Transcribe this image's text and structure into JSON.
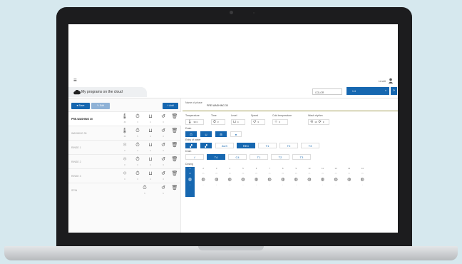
{
  "app": {
    "menu_icon": "menu-icon",
    "user_name": "Lenzitt",
    "cloud_title": "My programs on the cloud",
    "search_text": "COLOR",
    "select_value": "1 4",
    "select_clear": "×",
    "select_go": "»"
  },
  "toolbar": {
    "save_label": "Save",
    "edit_label": "Edit",
    "add_label": "Add"
  },
  "columns": [
    "temperature-icon",
    "time-icon",
    "level-icon",
    "speed-icon",
    "delete-icon"
  ],
  "programs": [
    {
      "name": "PRE-WASHING 30",
      "values": [
        "30",
        "3",
        "4",
        "3"
      ]
    },
    {
      "name": "WASHING 30",
      "values": [
        "30",
        "5",
        "4",
        "3"
      ]
    },
    {
      "name": "RINSE 1",
      "values": [
        "0",
        "3",
        "4",
        "3"
      ]
    },
    {
      "name": "RINSE 2",
      "values": [
        "0",
        "3",
        "4",
        "3"
      ]
    },
    {
      "name": "RINSE 3",
      "values": [
        "0",
        "3",
        "4",
        "3"
      ]
    },
    {
      "name": "SPIN",
      "values": [
        "",
        "5",
        "",
        "5"
      ]
    }
  ],
  "detail": {
    "name_label": "Name of phase",
    "name_value": "PRE-WASHING 30",
    "params": {
      "temperature": {
        "label": "Temperature",
        "value": "30 C"
      },
      "time": {
        "label": "Time",
        "value": "3"
      },
      "level": {
        "label": "Level",
        "value": "4"
      },
      "speed": {
        "label": "Speed",
        "value": "3"
      },
      "cold_temp": {
        "label": "Cold temperature",
        "value": "0"
      },
      "wash_rhythm": {
        "label": "Wash rhythm",
        "value1": "10",
        "value2": "3"
      }
    },
    "drain_section": "Drain",
    "entry_section": "Entry of water",
    "drain2_section": "Drain",
    "dosing_section": "Dosing",
    "entry_tiles": [
      "",
      "",
      "AUX",
      "REC",
      "T1",
      "T2",
      "T3"
    ],
    "drain_tiles": [
      "",
      "T4",
      "C4",
      "T1",
      "T2",
      "T3"
    ],
    "dosing": [
      {
        "n": "1"
      },
      {
        "n": "2"
      },
      {
        "n": "3"
      },
      {
        "n": "4"
      },
      {
        "n": "5"
      },
      {
        "n": "6"
      },
      {
        "n": "7"
      },
      {
        "n": "8"
      },
      {
        "n": "9"
      },
      {
        "n": "10"
      },
      {
        "n": "11"
      },
      {
        "n": "12"
      },
      {
        "n": "13"
      },
      {
        "n": "14"
      }
    ]
  },
  "colors": {
    "accent": "#1667b0",
    "olive_rule": "#a39d55",
    "laptop_bezel": "#1c1c1e",
    "background": "#d6e8ee"
  }
}
